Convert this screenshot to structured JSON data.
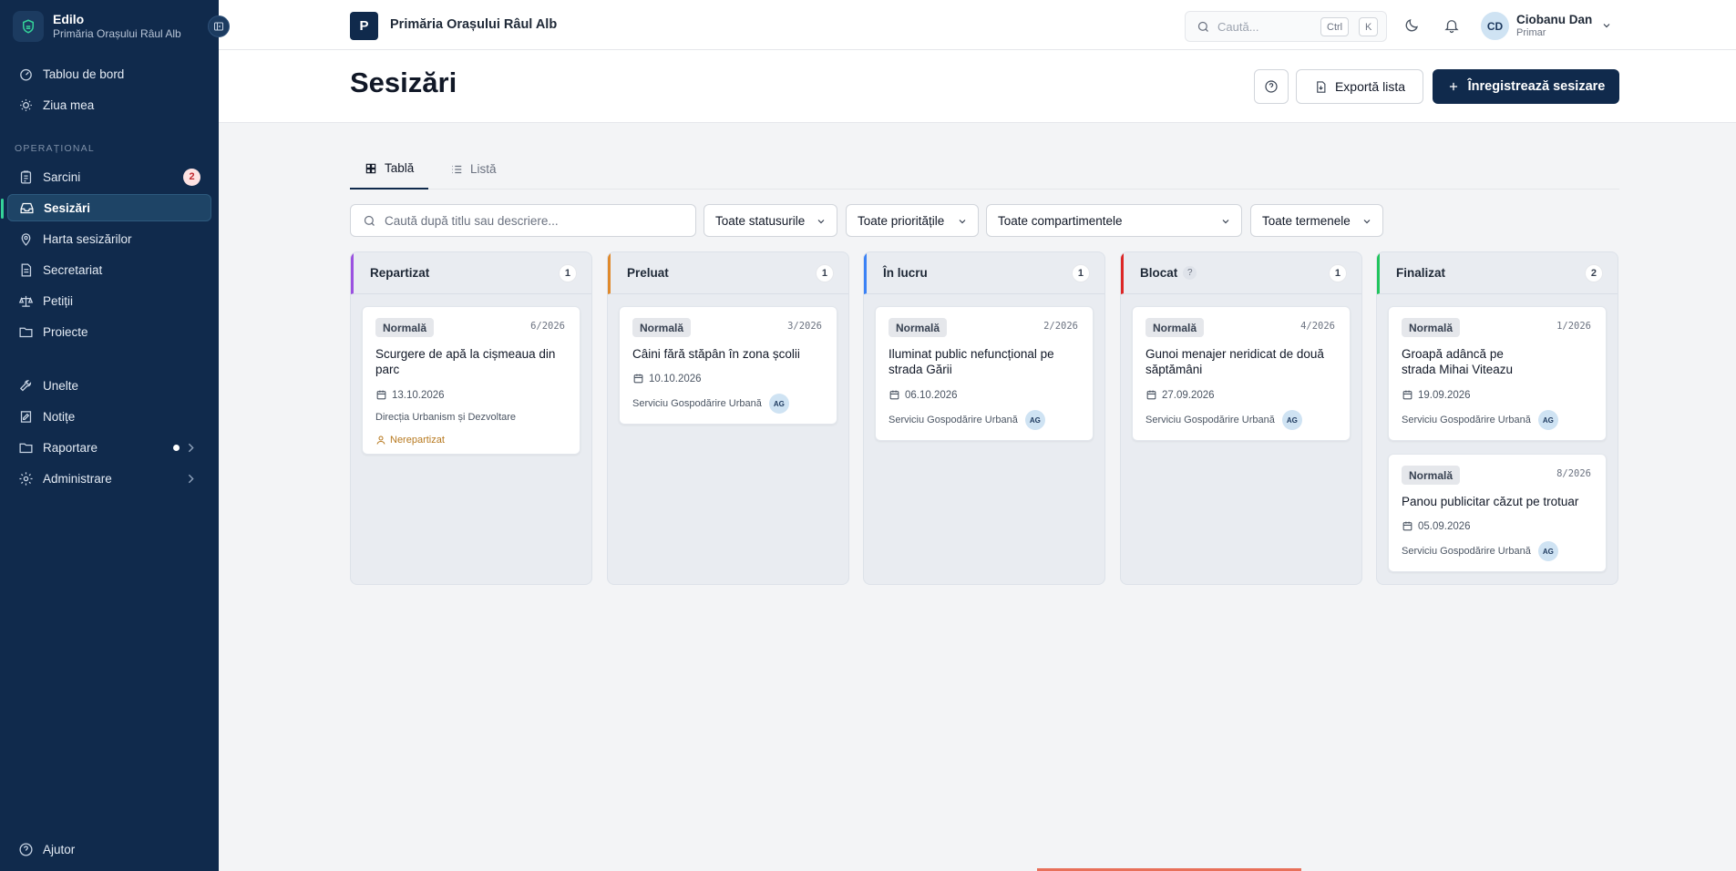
{
  "app": {
    "name": "Edilo",
    "org": "Primăria Orașului Râul Alb"
  },
  "sidebar": {
    "top_items": [
      {
        "label": "Tablou de bord",
        "icon": "dashboard-icon"
      },
      {
        "label": "Ziua mea",
        "icon": "sun-icon"
      }
    ],
    "section_label": "OPERAȚIONAL",
    "ops_items": [
      {
        "label": "Sarcini",
        "icon": "clipboard-icon",
        "badge": "2"
      },
      {
        "label": "Sesizări",
        "icon": "inbox-icon",
        "active": true
      },
      {
        "label": "Harta sesizărilor",
        "icon": "map-pin-icon"
      },
      {
        "label": "Secretariat",
        "icon": "document-icon"
      },
      {
        "label": "Petiții",
        "icon": "scale-icon"
      },
      {
        "label": "Proiecte",
        "icon": "folder-icon"
      }
    ],
    "tools_items": [
      {
        "label": "Unelte",
        "icon": "wrench-icon"
      },
      {
        "label": "Notițe",
        "icon": "note-icon"
      },
      {
        "label": "Raportare",
        "icon": "folder-icon"
      },
      {
        "label": "Administrare",
        "icon": "gear-icon"
      }
    ],
    "help_label": "Ajutor"
  },
  "topbar": {
    "org_initial": "P",
    "org_name": "Primăria Orașului Râul Alb",
    "search_placeholder": "Caută...",
    "kbd_ctrl": "Ctrl",
    "kbd_k": "K",
    "user_initials": "CD",
    "user_name": "Ciobanu Dan",
    "user_role": "Primar"
  },
  "header": {
    "title": "Sesizări",
    "export_label": "Exportă lista",
    "register_label": "Înregistrează sesizare"
  },
  "tabs": [
    {
      "label": "Tablă",
      "active": true
    },
    {
      "label": "Listă"
    }
  ],
  "filters": {
    "search_placeholder": "Caută după titlu sau descriere...",
    "status": "Toate statusurile",
    "priority": "Toate prioritățile",
    "department": "Toate compartimentele",
    "deadline": "Toate termenele"
  },
  "colors": {
    "sidebar_bg": "#102a4c",
    "accent_green": "#34d399",
    "repartizat": "#9b51e0",
    "preluat": "#e08a2c",
    "in_lucru": "#3b82f6",
    "blocat": "#dc2626",
    "finalizat": "#22c55e"
  },
  "columns": [
    {
      "key": "repartizat",
      "name": "Repartizat",
      "count": "1",
      "cards": [
        {
          "priority": "Normală",
          "number": "6/2026",
          "title": "Scurgere de apă la cișmeaua din parc",
          "date": "13.10.2026",
          "department": "Direcția Urbanism și Dezvoltare",
          "unassigned": "Nerepartizat"
        }
      ]
    },
    {
      "key": "preluat",
      "name": "Preluat",
      "count": "1",
      "cards": [
        {
          "priority": "Normală",
          "number": "3/2026",
          "title": "Câini fără stăpân în zona școlii",
          "date": "10.10.2026",
          "department": "Serviciu Gospodărire Urbană",
          "assignee": "AG"
        }
      ]
    },
    {
      "key": "in_lucru",
      "name": "În lucru",
      "count": "1",
      "cards": [
        {
          "priority": "Normală",
          "number": "2/2026",
          "title": "Iluminat public nefuncțional pe strada Gării",
          "date": "06.10.2026",
          "department": "Serviciu Gospodărire Urbană",
          "assignee": "AG"
        }
      ]
    },
    {
      "key": "blocat",
      "name": "Blocat",
      "count": "1",
      "help": "?",
      "cards": [
        {
          "priority": "Normală",
          "number": "4/2026",
          "title": "Gunoi menajer neridicat de două săptămâni",
          "date": "27.09.2026",
          "department": "Serviciu Gospodărire Urbană",
          "assignee": "AG"
        }
      ]
    },
    {
      "key": "finalizat",
      "name": "Finalizat",
      "count": "2",
      "cards": [
        {
          "priority": "Normală",
          "number": "1/2026",
          "title": "Groapă adâncă pe strada Mihai Viteazu",
          "date": "19.09.2026",
          "department": "Serviciu Gospodărire Urbană",
          "assignee": "AG"
        },
        {
          "priority": "Normală",
          "number": "8/2026",
          "title": "Panou publicitar căzut pe trotuar",
          "date": "05.09.2026",
          "department": "Serviciu Gospodărire Urbană",
          "assignee": "AG"
        }
      ]
    }
  ]
}
